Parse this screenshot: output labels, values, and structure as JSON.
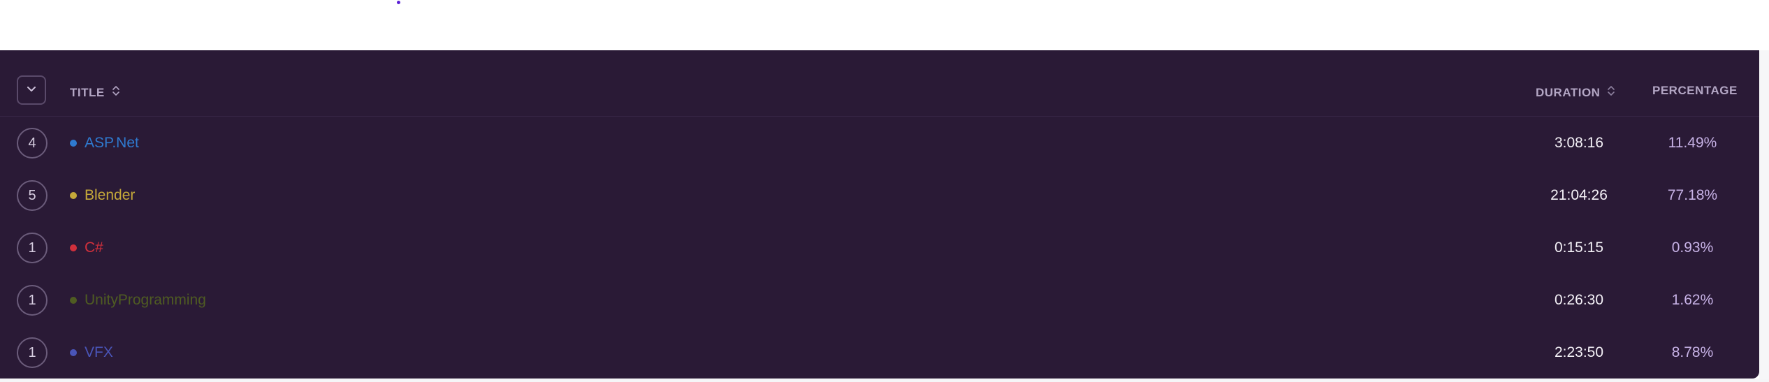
{
  "table": {
    "headers": {
      "title": "TITLE",
      "duration": "DURATION",
      "percentage": "PERCENTAGE"
    },
    "rows": [
      {
        "count": "4",
        "title": "ASP.Net",
        "color": "#2f7ad0",
        "duration": "3:08:16",
        "percentage": "11.49%"
      },
      {
        "count": "5",
        "title": "Blender",
        "color": "#c5a93a",
        "duration": "21:04:26",
        "percentage": "77.18%"
      },
      {
        "count": "1",
        "title": "C#",
        "color": "#d1303c",
        "duration": "0:15:15",
        "percentage": "0.93%"
      },
      {
        "count": "1",
        "title": "UnityProgramming",
        "color": "#4f5c22",
        "duration": "0:26:30",
        "percentage": "1.62%"
      },
      {
        "count": "1",
        "title": "VFX",
        "color": "#4a55b8",
        "duration": "2:23:50",
        "percentage": "8.78%"
      }
    ]
  },
  "icons": {
    "toggle": "chevron-down-icon",
    "sort": "sort-icon"
  },
  "colors": {
    "panel_background": "#2a1a36",
    "header_text": "#b3a6c4",
    "duration_text": "#f4f1f7",
    "percentage_text": "#c7b2e6"
  }
}
